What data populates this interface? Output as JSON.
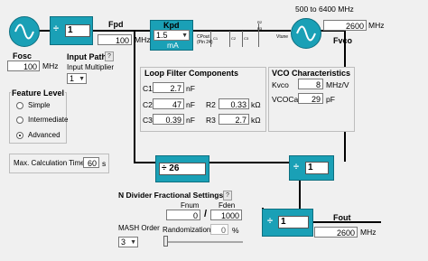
{
  "fosc": {
    "label": "Fosc",
    "value": "100",
    "unit": "MHz"
  },
  "ref_divider": {
    "symbol": "÷",
    "value": "1"
  },
  "fpd": {
    "label": "Fpd",
    "value": "100",
    "unit": "MHz"
  },
  "kpd": {
    "label": "Kpd",
    "value": "1.5",
    "unit": "mA"
  },
  "cpout": {
    "label": "CPout\n(Pin 24)"
  },
  "vtune": {
    "label": "Vtune"
  },
  "component_tags": [
    "R2",
    "R3",
    "C1",
    "C2",
    "C3"
  ],
  "vco": {
    "range": "500 to 6400 MHz",
    "fvco_label": "Fvco",
    "fvco_value": "2600",
    "unit": "MHz"
  },
  "input_path": {
    "title": "Input Path",
    "help": "?",
    "multiplier_label": "Input Multiplier",
    "multiplier_value": "1"
  },
  "feature_level": {
    "title": "Feature Level",
    "options": [
      "Simple",
      "Intermediate",
      "Advanced"
    ],
    "selected": "Advanced"
  },
  "max_calc": {
    "label": "Max. Calculation Time",
    "value": "60",
    "unit": "s"
  },
  "loop_filter": {
    "title": "Loop Filter Components",
    "c1": {
      "label": "C1",
      "value": "2.7",
      "unit": "nF"
    },
    "c2": {
      "label": "C2",
      "value": "47",
      "unit": "nF"
    },
    "c3": {
      "label": "C3",
      "value": "0.39",
      "unit": "nF"
    },
    "r2": {
      "label": "R2",
      "value": "0.33",
      "unit": "kΩ"
    },
    "r3": {
      "label": "R3",
      "value": "2.7",
      "unit": "kΩ"
    }
  },
  "vco_char": {
    "title": "VCO Characteristics",
    "kvco": {
      "label": "Kvco",
      "value": "8",
      "unit": "MHz/V"
    },
    "vcocap": {
      "label": "VCOCap",
      "value": "29",
      "unit": "pF"
    }
  },
  "n_divider": {
    "symbol": "÷",
    "value": "26"
  },
  "vco_divider": {
    "symbol": "÷",
    "value": "1"
  },
  "out_divider": {
    "symbol": "÷",
    "value": "1"
  },
  "n_frac": {
    "title": "N Divider Fractional Settings",
    "help": "?",
    "fnum_label": "Fnum",
    "fnum_value": "0",
    "slash": "/",
    "fden_label": "Fden",
    "fden_value": "1000",
    "mash_label": "MASH Order",
    "mash_value": "3",
    "random_label": "Randomization",
    "random_value": "0",
    "random_pct": "%",
    "slider_fraction": 0.0
  },
  "fout": {
    "label": "Fout",
    "value": "2600",
    "unit": "MHz"
  }
}
